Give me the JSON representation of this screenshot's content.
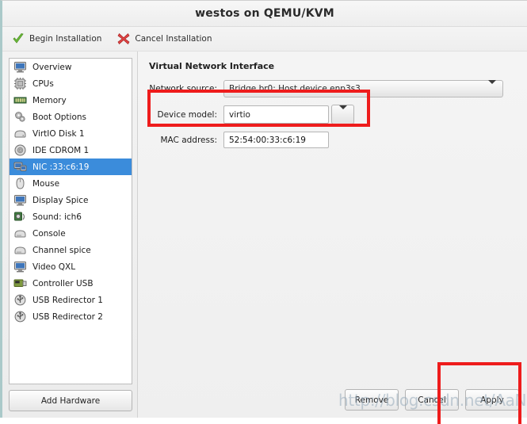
{
  "window": {
    "title": "westos on QEMU/KVM"
  },
  "toolbar": {
    "begin_label": "Begin Installation",
    "begin_icon": "green-check-icon",
    "cancel_label": "Cancel Installation",
    "cancel_icon": "red-x-icon"
  },
  "sidebar": {
    "items": [
      {
        "label": "Overview",
        "icon": "monitor-icon",
        "selected": false
      },
      {
        "label": "CPUs",
        "icon": "cpu-chip-icon",
        "selected": false
      },
      {
        "label": "Memory",
        "icon": "memory-stick-icon",
        "selected": false
      },
      {
        "label": "Boot Options",
        "icon": "gears-icon",
        "selected": false
      },
      {
        "label": "VirtIO Disk 1",
        "icon": "hard-disk-icon",
        "selected": false
      },
      {
        "label": "IDE CDROM 1",
        "icon": "cdrom-disc-icon",
        "selected": false
      },
      {
        "label": "NIC :33:c6:19",
        "icon": "network-card-icon",
        "selected": true
      },
      {
        "label": "Mouse",
        "icon": "mouse-icon",
        "selected": false
      },
      {
        "label": "Display Spice",
        "icon": "monitor-icon",
        "selected": false
      },
      {
        "label": "Sound: ich6",
        "icon": "speaker-icon",
        "selected": false
      },
      {
        "label": "Console",
        "icon": "console-icon",
        "selected": false
      },
      {
        "label": "Channel spice",
        "icon": "console-icon",
        "selected": false
      },
      {
        "label": "Video QXL",
        "icon": "monitor-icon",
        "selected": false
      },
      {
        "label": "Controller USB",
        "icon": "controller-card-icon",
        "selected": false
      },
      {
        "label": "USB Redirector 1",
        "icon": "usb-icon",
        "selected": false
      },
      {
        "label": "USB Redirector 2",
        "icon": "usb-icon",
        "selected": false
      }
    ],
    "add_hardware_label": "Add Hardware"
  },
  "main": {
    "section_title": "Virtual Network Interface",
    "fields": {
      "network_source": {
        "label": "Network source:",
        "value": "Bridge br0: Host device enp3s3",
        "control": "combobox"
      },
      "device_model": {
        "label": "Device model:",
        "value": "virtio",
        "control": "editable-combobox"
      },
      "mac_address": {
        "label": "MAC address:",
        "value": "52:54:00:33:c6:19",
        "control": "textfield"
      }
    },
    "buttons": {
      "remove": "Remove",
      "cancel": "Cancel",
      "apply": "Apply"
    }
  },
  "overlay": {
    "watermark_text": "http://blog.csdn.net/AaNiaoMan",
    "annotation_color": "#ee1c1c"
  }
}
